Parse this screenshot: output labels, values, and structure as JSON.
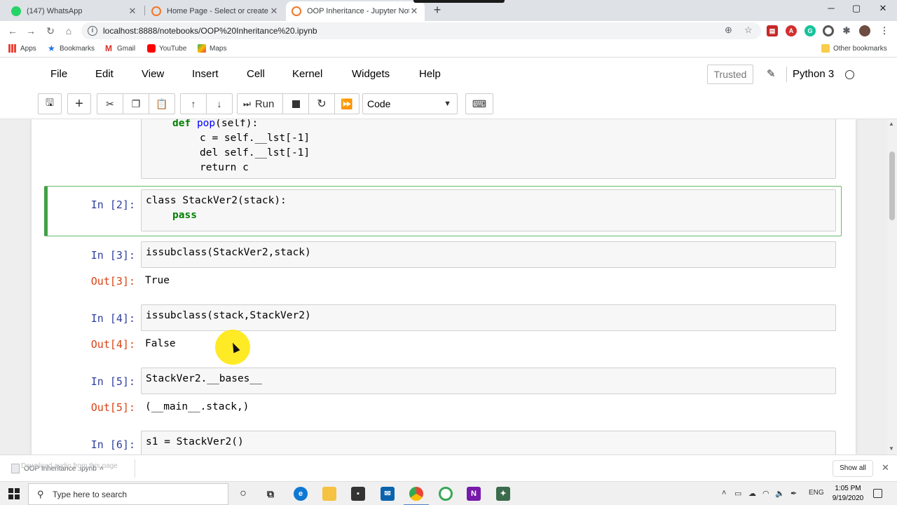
{
  "browser": {
    "tabs": [
      {
        "title": "(147) WhatsApp",
        "favicon_color": "#25d366"
      },
      {
        "title": "Home Page - Select or create a n",
        "favicon_color": "#f37726"
      },
      {
        "title": "OOP Inheritance - Jupyter Noteb",
        "favicon_color": "#f37726"
      }
    ],
    "new_tab": "+",
    "url": "localhost:8888/notebooks/OOP%20Inheritance%20.ipynb",
    "bookmarks": [
      {
        "label": "Apps",
        "icon": "apps-grid-icon"
      },
      {
        "label": "Bookmarks",
        "icon": "star-icon"
      },
      {
        "label": "Gmail",
        "icon": "gmail-icon"
      },
      {
        "label": "YouTube",
        "icon": "youtube-icon"
      },
      {
        "label": "Maps",
        "icon": "maps-icon"
      }
    ],
    "other_bookmarks": "Other bookmarks"
  },
  "jupyter": {
    "menu": [
      "File",
      "Edit",
      "View",
      "Insert",
      "Cell",
      "Kernel",
      "Widgets",
      "Help"
    ],
    "trusted": "Trusted",
    "kernel": "Python 3",
    "run_label": "Run",
    "cell_type": "Code"
  },
  "notebook": {
    "cell1_code": [
      "def pop(self):",
      "c = self.__lst[-1]",
      "del self.__lst[-1]",
      "return c"
    ],
    "cells": [
      {
        "in": "In [2]:",
        "code": [
          "class StackVer2(stack):",
          "pass"
        ]
      },
      {
        "in": "In [3]:",
        "code": "issubclass(StackVer2,stack)",
        "out_label": "Out[3]:",
        "out": "True"
      },
      {
        "in": "In [4]:",
        "code": "issubclass(stack,StackVer2)",
        "out_label": "Out[4]:",
        "out": "False"
      },
      {
        "in": "In [5]:",
        "code": "StackVer2.__bases__",
        "out_label": "Out[5]:",
        "out": "(__main__.stack,)"
      },
      {
        "in": "In [6]:",
        "code": "s1 = StackVer2()"
      }
    ]
  },
  "downloads": {
    "file": "OOP Inheritance .ipynb",
    "tooltip": "Download audio from this page",
    "show_all": "Show all"
  },
  "taskbar": {
    "search_placeholder": "Type here to search",
    "language": "ENG",
    "time": "1:05 PM",
    "date": "9/19/2020"
  },
  "colors": {
    "selected_cell_border": "#42a047",
    "prompt_in": "#303f9f",
    "prompt_out": "#d84315"
  }
}
